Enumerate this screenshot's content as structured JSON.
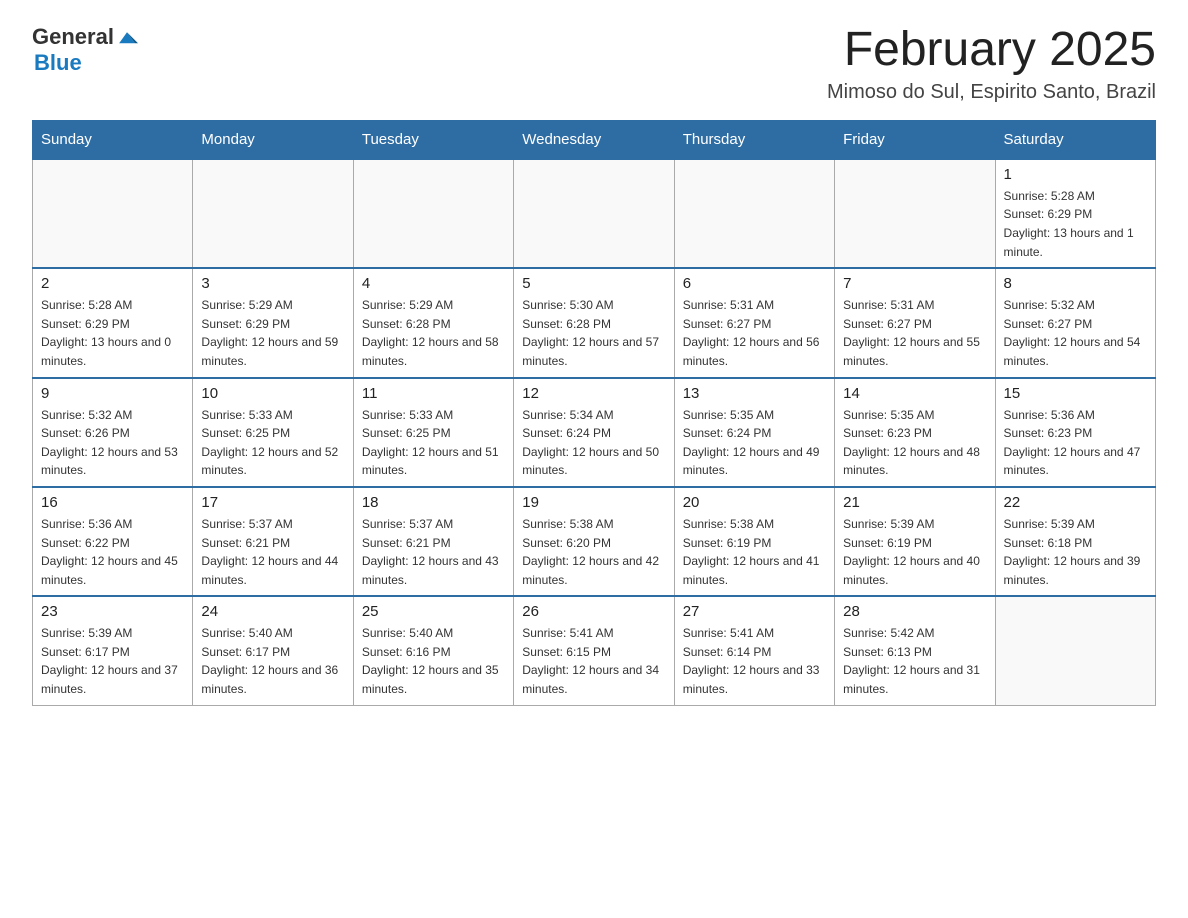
{
  "header": {
    "logo": {
      "general": "General",
      "blue": "Blue",
      "icon_alt": "GeneralBlue logo"
    },
    "title": "February 2025",
    "location": "Mimoso do Sul, Espirito Santo, Brazil"
  },
  "days_of_week": [
    "Sunday",
    "Monday",
    "Tuesday",
    "Wednesday",
    "Thursday",
    "Friday",
    "Saturday"
  ],
  "weeks": [
    {
      "days": [
        {
          "num": "",
          "sunrise": "",
          "sunset": "",
          "daylight": "",
          "empty": true
        },
        {
          "num": "",
          "sunrise": "",
          "sunset": "",
          "daylight": "",
          "empty": true
        },
        {
          "num": "",
          "sunrise": "",
          "sunset": "",
          "daylight": "",
          "empty": true
        },
        {
          "num": "",
          "sunrise": "",
          "sunset": "",
          "daylight": "",
          "empty": true
        },
        {
          "num": "",
          "sunrise": "",
          "sunset": "",
          "daylight": "",
          "empty": true
        },
        {
          "num": "",
          "sunrise": "",
          "sunset": "",
          "daylight": "",
          "empty": true
        },
        {
          "num": "1",
          "sunrise": "Sunrise: 5:28 AM",
          "sunset": "Sunset: 6:29 PM",
          "daylight": "Daylight: 13 hours and 1 minute.",
          "empty": false
        }
      ]
    },
    {
      "days": [
        {
          "num": "2",
          "sunrise": "Sunrise: 5:28 AM",
          "sunset": "Sunset: 6:29 PM",
          "daylight": "Daylight: 13 hours and 0 minutes.",
          "empty": false
        },
        {
          "num": "3",
          "sunrise": "Sunrise: 5:29 AM",
          "sunset": "Sunset: 6:29 PM",
          "daylight": "Daylight: 12 hours and 59 minutes.",
          "empty": false
        },
        {
          "num": "4",
          "sunrise": "Sunrise: 5:29 AM",
          "sunset": "Sunset: 6:28 PM",
          "daylight": "Daylight: 12 hours and 58 minutes.",
          "empty": false
        },
        {
          "num": "5",
          "sunrise": "Sunrise: 5:30 AM",
          "sunset": "Sunset: 6:28 PM",
          "daylight": "Daylight: 12 hours and 57 minutes.",
          "empty": false
        },
        {
          "num": "6",
          "sunrise": "Sunrise: 5:31 AM",
          "sunset": "Sunset: 6:27 PM",
          "daylight": "Daylight: 12 hours and 56 minutes.",
          "empty": false
        },
        {
          "num": "7",
          "sunrise": "Sunrise: 5:31 AM",
          "sunset": "Sunset: 6:27 PM",
          "daylight": "Daylight: 12 hours and 55 minutes.",
          "empty": false
        },
        {
          "num": "8",
          "sunrise": "Sunrise: 5:32 AM",
          "sunset": "Sunset: 6:27 PM",
          "daylight": "Daylight: 12 hours and 54 minutes.",
          "empty": false
        }
      ]
    },
    {
      "days": [
        {
          "num": "9",
          "sunrise": "Sunrise: 5:32 AM",
          "sunset": "Sunset: 6:26 PM",
          "daylight": "Daylight: 12 hours and 53 minutes.",
          "empty": false
        },
        {
          "num": "10",
          "sunrise": "Sunrise: 5:33 AM",
          "sunset": "Sunset: 6:25 PM",
          "daylight": "Daylight: 12 hours and 52 minutes.",
          "empty": false
        },
        {
          "num": "11",
          "sunrise": "Sunrise: 5:33 AM",
          "sunset": "Sunset: 6:25 PM",
          "daylight": "Daylight: 12 hours and 51 minutes.",
          "empty": false
        },
        {
          "num": "12",
          "sunrise": "Sunrise: 5:34 AM",
          "sunset": "Sunset: 6:24 PM",
          "daylight": "Daylight: 12 hours and 50 minutes.",
          "empty": false
        },
        {
          "num": "13",
          "sunrise": "Sunrise: 5:35 AM",
          "sunset": "Sunset: 6:24 PM",
          "daylight": "Daylight: 12 hours and 49 minutes.",
          "empty": false
        },
        {
          "num": "14",
          "sunrise": "Sunrise: 5:35 AM",
          "sunset": "Sunset: 6:23 PM",
          "daylight": "Daylight: 12 hours and 48 minutes.",
          "empty": false
        },
        {
          "num": "15",
          "sunrise": "Sunrise: 5:36 AM",
          "sunset": "Sunset: 6:23 PM",
          "daylight": "Daylight: 12 hours and 47 minutes.",
          "empty": false
        }
      ]
    },
    {
      "days": [
        {
          "num": "16",
          "sunrise": "Sunrise: 5:36 AM",
          "sunset": "Sunset: 6:22 PM",
          "daylight": "Daylight: 12 hours and 45 minutes.",
          "empty": false
        },
        {
          "num": "17",
          "sunrise": "Sunrise: 5:37 AM",
          "sunset": "Sunset: 6:21 PM",
          "daylight": "Daylight: 12 hours and 44 minutes.",
          "empty": false
        },
        {
          "num": "18",
          "sunrise": "Sunrise: 5:37 AM",
          "sunset": "Sunset: 6:21 PM",
          "daylight": "Daylight: 12 hours and 43 minutes.",
          "empty": false
        },
        {
          "num": "19",
          "sunrise": "Sunrise: 5:38 AM",
          "sunset": "Sunset: 6:20 PM",
          "daylight": "Daylight: 12 hours and 42 minutes.",
          "empty": false
        },
        {
          "num": "20",
          "sunrise": "Sunrise: 5:38 AM",
          "sunset": "Sunset: 6:19 PM",
          "daylight": "Daylight: 12 hours and 41 minutes.",
          "empty": false
        },
        {
          "num": "21",
          "sunrise": "Sunrise: 5:39 AM",
          "sunset": "Sunset: 6:19 PM",
          "daylight": "Daylight: 12 hours and 40 minutes.",
          "empty": false
        },
        {
          "num": "22",
          "sunrise": "Sunrise: 5:39 AM",
          "sunset": "Sunset: 6:18 PM",
          "daylight": "Daylight: 12 hours and 39 minutes.",
          "empty": false
        }
      ]
    },
    {
      "days": [
        {
          "num": "23",
          "sunrise": "Sunrise: 5:39 AM",
          "sunset": "Sunset: 6:17 PM",
          "daylight": "Daylight: 12 hours and 37 minutes.",
          "empty": false
        },
        {
          "num": "24",
          "sunrise": "Sunrise: 5:40 AM",
          "sunset": "Sunset: 6:17 PM",
          "daylight": "Daylight: 12 hours and 36 minutes.",
          "empty": false
        },
        {
          "num": "25",
          "sunrise": "Sunrise: 5:40 AM",
          "sunset": "Sunset: 6:16 PM",
          "daylight": "Daylight: 12 hours and 35 minutes.",
          "empty": false
        },
        {
          "num": "26",
          "sunrise": "Sunrise: 5:41 AM",
          "sunset": "Sunset: 6:15 PM",
          "daylight": "Daylight: 12 hours and 34 minutes.",
          "empty": false
        },
        {
          "num": "27",
          "sunrise": "Sunrise: 5:41 AM",
          "sunset": "Sunset: 6:14 PM",
          "daylight": "Daylight: 12 hours and 33 minutes.",
          "empty": false
        },
        {
          "num": "28",
          "sunrise": "Sunrise: 5:42 AM",
          "sunset": "Sunset: 6:13 PM",
          "daylight": "Daylight: 12 hours and 31 minutes.",
          "empty": false
        },
        {
          "num": "",
          "sunrise": "",
          "sunset": "",
          "daylight": "",
          "empty": true
        }
      ]
    }
  ]
}
